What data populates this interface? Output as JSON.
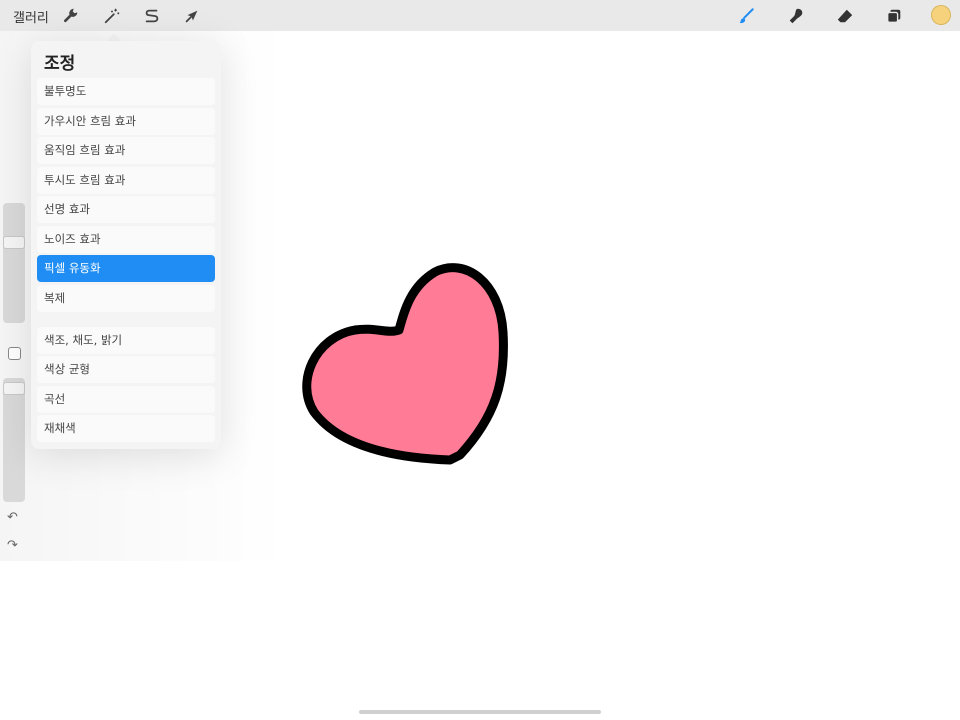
{
  "app": {
    "gallery_label": "갤러리",
    "accent_color": "#1f8df3",
    "current_color": "#f7d27d"
  },
  "toolbar_left": [
    {
      "icon": "wrench-icon"
    },
    {
      "icon": "magic-wand-icon"
    },
    {
      "icon": "selection-s-icon"
    },
    {
      "icon": "arrow-cursor-icon"
    }
  ],
  "toolbar_right": [
    {
      "icon": "brush-icon",
      "active": true
    },
    {
      "icon": "smudge-icon"
    },
    {
      "icon": "eraser-icon"
    },
    {
      "icon": "layers-icon"
    }
  ],
  "adjustments": {
    "title": "조정",
    "items": [
      {
        "label": "불투명도"
      },
      {
        "label": "가우시안 흐림 효과"
      },
      {
        "label": "움직임 흐림 효과"
      },
      {
        "label": "투시도 흐림 효과"
      },
      {
        "label": "선명 효과"
      },
      {
        "label": "노이즈 효과"
      },
      {
        "label": "픽셀 유동화",
        "selected": true
      },
      {
        "label": "복제"
      },
      {
        "label": "색조, 채도, 밝기"
      },
      {
        "label": "색상 균형"
      },
      {
        "label": "곡선"
      },
      {
        "label": "재채색"
      }
    ]
  },
  "canvas": {
    "shape": "heart",
    "fill_color": "#ff7b96",
    "stroke_color": "#000000"
  }
}
